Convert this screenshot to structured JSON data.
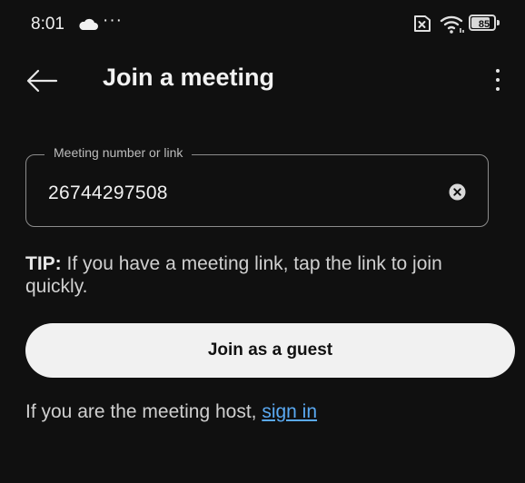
{
  "status_bar": {
    "time": "8:01",
    "more_dots": "···",
    "battery_level": "85",
    "battery_fraction": 0.85
  },
  "app_bar": {
    "title": "Join a meeting",
    "back_icon": "arrow-left-icon",
    "menu_icon": "more-vertical-icon"
  },
  "meeting_field": {
    "label": "Meeting number or link",
    "value": "26744297508",
    "clear_icon": "clear-circle-icon"
  },
  "tip": {
    "prefix": "TIP:",
    "text": " If you have a meeting link, tap the link to join quickly."
  },
  "join_button": {
    "label": "Join as a guest"
  },
  "host": {
    "text": "If you are the meeting host, ",
    "link_label": "sign in"
  },
  "colors": {
    "background": "#101010",
    "button_background": "#f1f1f1",
    "link": "#5aa9f2"
  }
}
